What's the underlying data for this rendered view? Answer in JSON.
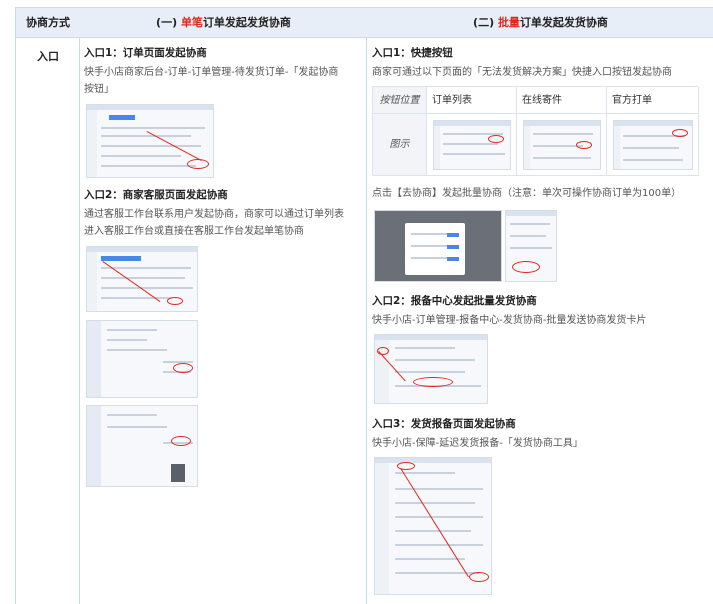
{
  "header": {
    "col1": "协商方式",
    "col2_prefix": "(一) ",
    "col2_red": "单笔",
    "col2_suffix": "订单发起发货协商",
    "col3_prefix": "(二) ",
    "col3_red": "批量",
    "col3_suffix": "订单发起发货协商"
  },
  "row_label": "入口",
  "single": {
    "entry1_title": "入口1：订单页面发起协商",
    "entry1_desc_l1": "快手小店商家后台-订单-订单管理-待发货订单-「发起协商",
    "entry1_desc_l2": "按钮」",
    "entry2_title": "入口2：商家客服页面发起协商",
    "entry2_desc_l1": "通过客服工作台联系用户发起协商，商家可以通过订单列表",
    "entry2_desc_l2": "进入客服工作台或直接在客服工作台发起单笔协商"
  },
  "batch": {
    "entry1_title": "入口1：快捷按钮",
    "entry1_desc": "商家可通过以下页面的「无法发货解决方案」快捷入口按钮发起协商",
    "grid": {
      "row1_label": "按钮位置",
      "row2_label": "图示",
      "cols": [
        "订单列表",
        "在线寄件",
        "官方打单"
      ]
    },
    "note": "点击【去协商】发起批量协商（注意：单次可操作协商订单为100单）",
    "entry2_title": "入口2：报备中心发起批量发货协商",
    "entry2_desc": "快手小店-订单管理-报备中心-发货协商-批量发送协商发货卡片",
    "entry3_title": "入口3：发货报备页面发起协商",
    "entry3_desc": "快手小店-保障-延迟发货报备-「发货协商工具」"
  },
  "colors": {
    "header_bg": "#e8eef7",
    "accent_red": "#e0281f",
    "border": "#cdd9e8"
  }
}
